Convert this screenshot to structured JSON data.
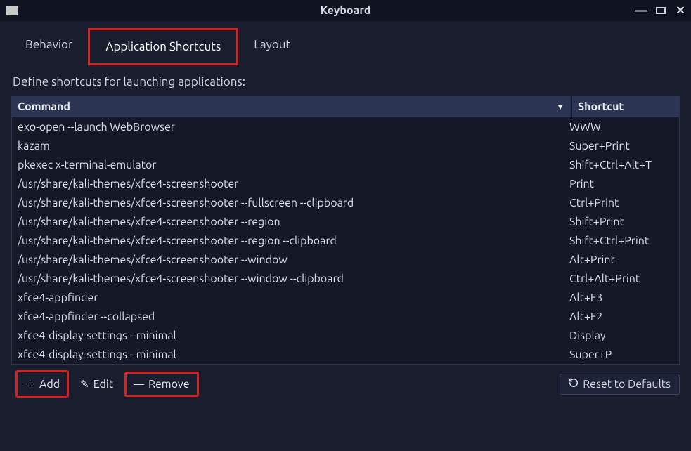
{
  "window": {
    "title": "Keyboard"
  },
  "tabs": {
    "behavior": "Behavior",
    "app_shortcuts": "Application Shortcuts",
    "layout": "Layout"
  },
  "description": "Define shortcuts for launching applications:",
  "headers": {
    "command": "Command",
    "shortcut": "Shortcut"
  },
  "rows": [
    {
      "cmd": "exo-open --launch WebBrowser",
      "shortcut": "WWW"
    },
    {
      "cmd": "kazam",
      "shortcut": "Super+Print"
    },
    {
      "cmd": "pkexec x-terminal-emulator",
      "shortcut": "Shift+Ctrl+Alt+T"
    },
    {
      "cmd": "/usr/share/kali-themes/xfce4-screenshooter",
      "shortcut": "Print"
    },
    {
      "cmd": "/usr/share/kali-themes/xfce4-screenshooter --fullscreen --clipboard",
      "shortcut": "Ctrl+Print"
    },
    {
      "cmd": "/usr/share/kali-themes/xfce4-screenshooter --region",
      "shortcut": "Shift+Print"
    },
    {
      "cmd": "/usr/share/kali-themes/xfce4-screenshooter --region --clipboard",
      "shortcut": "Shift+Ctrl+Print"
    },
    {
      "cmd": "/usr/share/kali-themes/xfce4-screenshooter --window",
      "shortcut": "Alt+Print"
    },
    {
      "cmd": "/usr/share/kali-themes/xfce4-screenshooter --window --clipboard",
      "shortcut": "Ctrl+Alt+Print"
    },
    {
      "cmd": "xfce4-appfinder",
      "shortcut": "Alt+F3"
    },
    {
      "cmd": "xfce4-appfinder --collapsed",
      "shortcut": "Alt+F2"
    },
    {
      "cmd": "xfce4-display-settings --minimal",
      "shortcut": "Display"
    },
    {
      "cmd": "xfce4-display-settings --minimal",
      "shortcut": "Super+P"
    }
  ],
  "buttons": {
    "add": "Add",
    "edit": "Edit",
    "remove": "Remove",
    "reset": "Reset to Defaults"
  }
}
